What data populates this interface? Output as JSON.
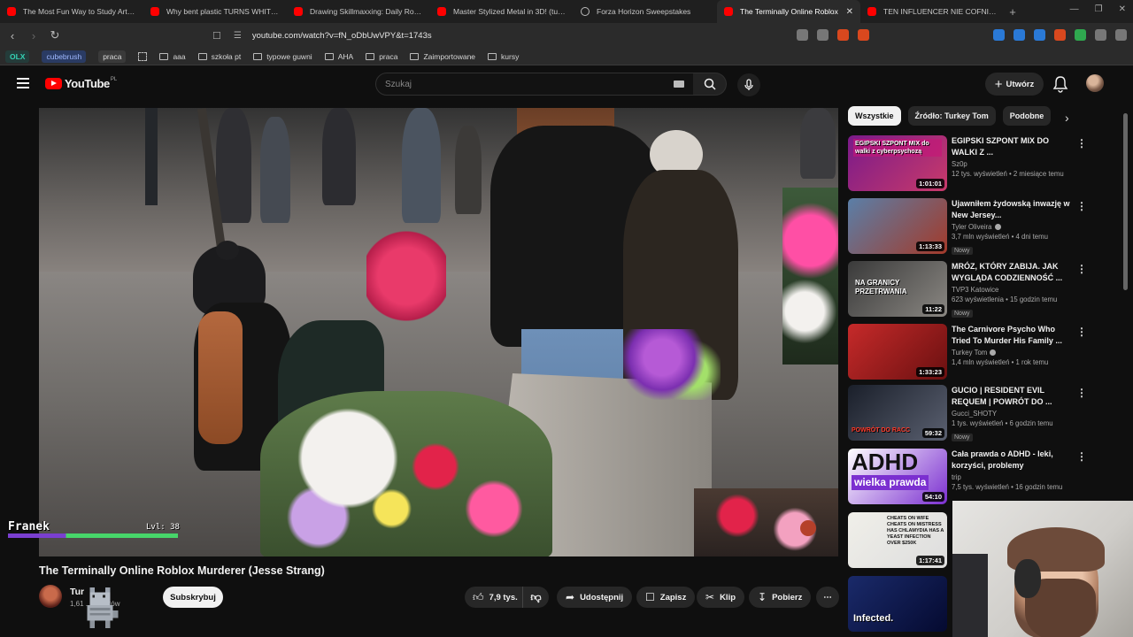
{
  "browser": {
    "tabs": [
      {
        "title": "The Most Fun Way to Study Art (Sch",
        "icon": "youtube"
      },
      {
        "title": "Why bent plastic TURNS WHITE (on",
        "icon": "youtube"
      },
      {
        "title": "Drawing Skillmaxxing: Daily Routine",
        "icon": "youtube"
      },
      {
        "title": "Master Stylized Metal in 3D! (tutoria",
        "icon": "youtube"
      },
      {
        "title": "Forza Horizon Sweepstakes",
        "icon": "globe"
      },
      {
        "title": "The Terminally Online Roblox",
        "icon": "youtube",
        "active": true
      },
      {
        "title": "TEN INFLUENCER NIE COFNIE SIĘ PI",
        "icon": "youtube"
      }
    ],
    "url": "youtube.com/watch?v=fN_oDbUwVPY&t=1743s",
    "bookmarks": [
      {
        "label": "OLX",
        "kind": "olx"
      },
      {
        "label": "cubebrush",
        "kind": "cb"
      },
      {
        "label": "praca",
        "kind": "pr"
      },
      {
        "label": "aaa",
        "kind": "folder"
      },
      {
        "label": "szkoła pt",
        "kind": "folder"
      },
      {
        "label": "typowe guwni",
        "kind": "folder"
      },
      {
        "label": "AHA",
        "kind": "folder"
      },
      {
        "label": "praca",
        "kind": "folder"
      },
      {
        "label": "Zaimportowane",
        "kind": "folder"
      },
      {
        "label": "kursy",
        "kind": "folder"
      }
    ]
  },
  "youtube": {
    "logo_text": "YouTube",
    "country": "PL",
    "search_placeholder": "Szukaj",
    "create_label": "Utwórz"
  },
  "player": {
    "overlay_name": "Franek",
    "overlay_level": "Lvl: 38",
    "overlay_progress": 0.34
  },
  "video": {
    "title": "The Terminally Online Roblox Murderer (Jesse Strang)",
    "channel_name": "Tur",
    "channel_subs": "1,61 ... ybentów",
    "subscribe_label": "Subskrybuj",
    "likes": "7,9 tys.",
    "share_label": "Udostępnij",
    "save_label": "Zapisz",
    "clip_label": "Klip",
    "download_label": "Pobierz"
  },
  "chips": [
    "Wszystkie",
    "Źródło: Turkey Tom",
    "Podobne"
  ],
  "recommendations": [
    {
      "title": "EGIPSKI SZPONT MIX DO WALKI Z ...",
      "channel": "Sz0p",
      "views": "12 tys. wyświetleń • 2 miesiące temu",
      "duration": "1:01:01",
      "verified": false,
      "new": false,
      "thumb_text": "EGIPSKI SZPONT MIX do walki z cyberpsychozą",
      "colors": [
        "#7a1a8a",
        "#c93a6a"
      ]
    },
    {
      "title": "Ujawniłem żydowską inwazję w New Jersey...",
      "channel": "Tyler Oliveira",
      "views": "3,7 mln wyświetleń • 4 dni temu",
      "duration": "1:13:33",
      "verified": true,
      "new": true,
      "thumb_text": "",
      "colors": [
        "#5a7fa8",
        "#a33a2a"
      ]
    },
    {
      "title": "MRÓZ, KTÓRY ZABIJA. JAK WYGLĄDA CODZIENNOŚĆ ...",
      "channel": "TVP3 Katowice",
      "views": "623 wyświetlenia • 15 godzin temu",
      "duration": "11:22",
      "verified": false,
      "new": true,
      "thumb_text": "NA GRANICY PRZETRWANIA",
      "colors": [
        "#3a3a3a",
        "#8a8782"
      ]
    },
    {
      "title": "The Carnivore Psycho Who Tried To Murder His Family ...",
      "channel": "Turkey Tom",
      "views": "1,4 mln wyświetleń • 1 rok temu",
      "duration": "1:33:23",
      "verified": true,
      "new": false,
      "thumb_text": "",
      "colors": [
        "#c62a2a",
        "#6a1010"
      ]
    },
    {
      "title": "GUCIO | RESIDENT EVIL REQUEM | POWRÓT DO ...",
      "channel": "Gucci_SHOTY",
      "views": "1 tys. wyświetleń • 6 godzin temu",
      "duration": "59:32",
      "verified": false,
      "new": true,
      "thumb_text": "POWRÓT DO RACC",
      "colors": [
        "#1a1f2a",
        "#5a6070"
      ]
    },
    {
      "title": "Cała prawda o ADHD - leki, korzyści, problemy",
      "channel": "trip",
      "views": "7,5 tys. wyświetleń • 16 godzin temu",
      "duration": "54:10",
      "verified": false,
      "new": false,
      "thumb_text": "ADHD wielka prawda",
      "colors": [
        "#ffffff",
        "#7b2fd0"
      ]
    },
    {
      "title": "",
      "channel": "",
      "views": "",
      "duration": "1:17:41",
      "verified": false,
      "new": false,
      "thumb_text": "CHEATS ON WIFE CHEATS ON MISTRESS HAS CHLAMYDIA HAS A YEAST INFECTION OVER $250K",
      "colors": [
        "#f0efe9",
        "#ddd"
      ]
    },
    {
      "title": "",
      "channel": "",
      "views": "",
      "duration": "",
      "verified": false,
      "new": false,
      "thumb_text": "Infected.",
      "colors": [
        "#1a2a6a",
        "#050a30"
      ]
    }
  ]
}
